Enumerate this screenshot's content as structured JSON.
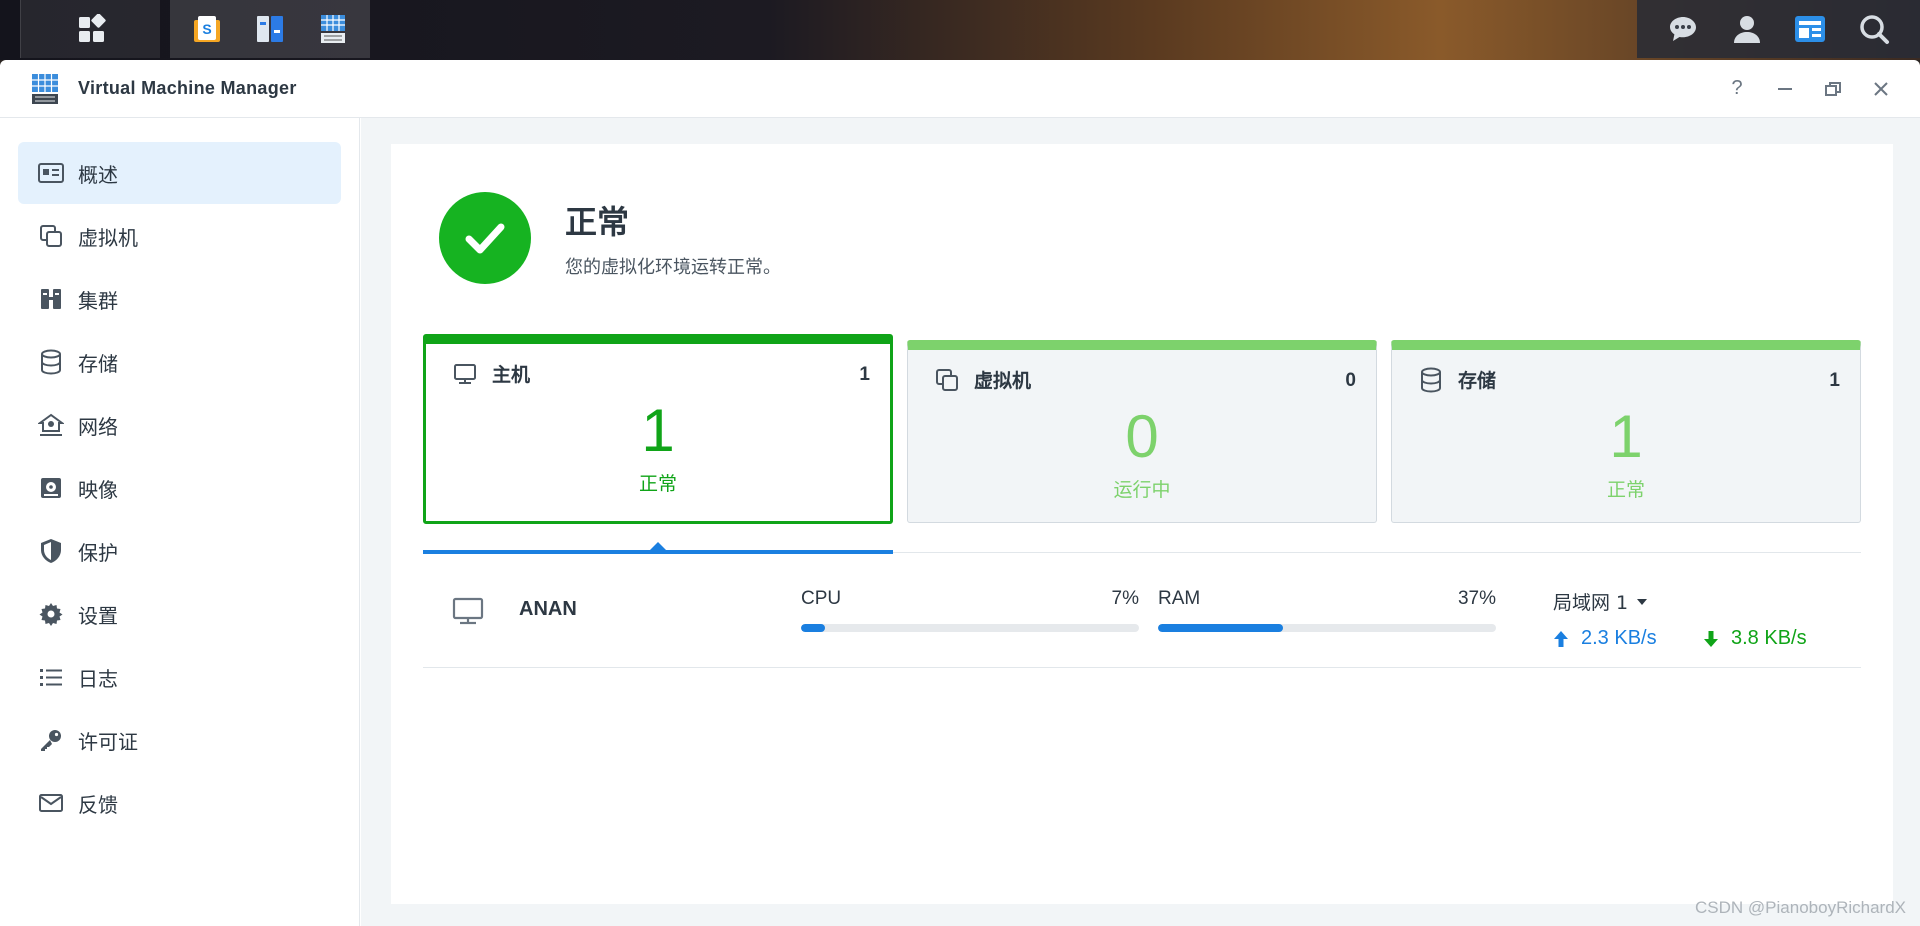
{
  "taskbar": {
    "main_menu_icon": "grid-icon",
    "apps": [
      "package-center-icon",
      "control-panel-icon",
      "vmm-icon"
    ],
    "right_icons": [
      "chat-icon",
      "user-icon",
      "widgets-icon",
      "search-icon"
    ]
  },
  "window": {
    "title": "Virtual Machine Manager",
    "controls": {
      "help": "?",
      "minimize": "–",
      "restore": "❐",
      "close": "✕"
    }
  },
  "sidebar": {
    "items": [
      {
        "label": "概述",
        "icon": "overview-icon",
        "active": true
      },
      {
        "label": "虚拟机",
        "icon": "virtual-machine-icon"
      },
      {
        "label": "集群",
        "icon": "cluster-icon"
      },
      {
        "label": "存储",
        "icon": "storage-icon"
      },
      {
        "label": "网络",
        "icon": "network-icon"
      },
      {
        "label": "映像",
        "icon": "image-icon"
      },
      {
        "label": "保护",
        "icon": "shield-icon"
      },
      {
        "label": "设置",
        "icon": "gear-icon"
      },
      {
        "label": "日志",
        "icon": "log-icon"
      },
      {
        "label": "许可证",
        "icon": "key-icon"
      },
      {
        "label": "反馈",
        "icon": "mail-icon"
      }
    ]
  },
  "status": {
    "title": "正常",
    "description": "您的虚拟化环境运转正常。",
    "color": "#16b321"
  },
  "cards": [
    {
      "name": "主机",
      "count": "1",
      "big": "1",
      "sub": "正常",
      "icon": "monitor-icon",
      "selected": true
    },
    {
      "name": "虚拟机",
      "count": "0",
      "big": "0",
      "sub": "运行中",
      "icon": "virtual-machine-icon",
      "selected": false
    },
    {
      "name": "存储",
      "count": "1",
      "big": "1",
      "sub": "正常",
      "icon": "storage-icon",
      "selected": false
    }
  ],
  "host": {
    "name": "ANAN",
    "cpu_label": "CPU",
    "cpu_value": "7%",
    "cpu_fraction": 0.07,
    "ram_label": "RAM",
    "ram_value": "37%",
    "ram_fraction": 0.37,
    "network_select": "局域网 1",
    "upload": "2.3 KB/s",
    "download": "3.8 KB/s"
  },
  "colors": {
    "accent": "#1a7fe0",
    "ok_green": "#10a418",
    "light_green": "#7dd26c"
  },
  "watermark": "CSDN @PianoboyRichardX"
}
